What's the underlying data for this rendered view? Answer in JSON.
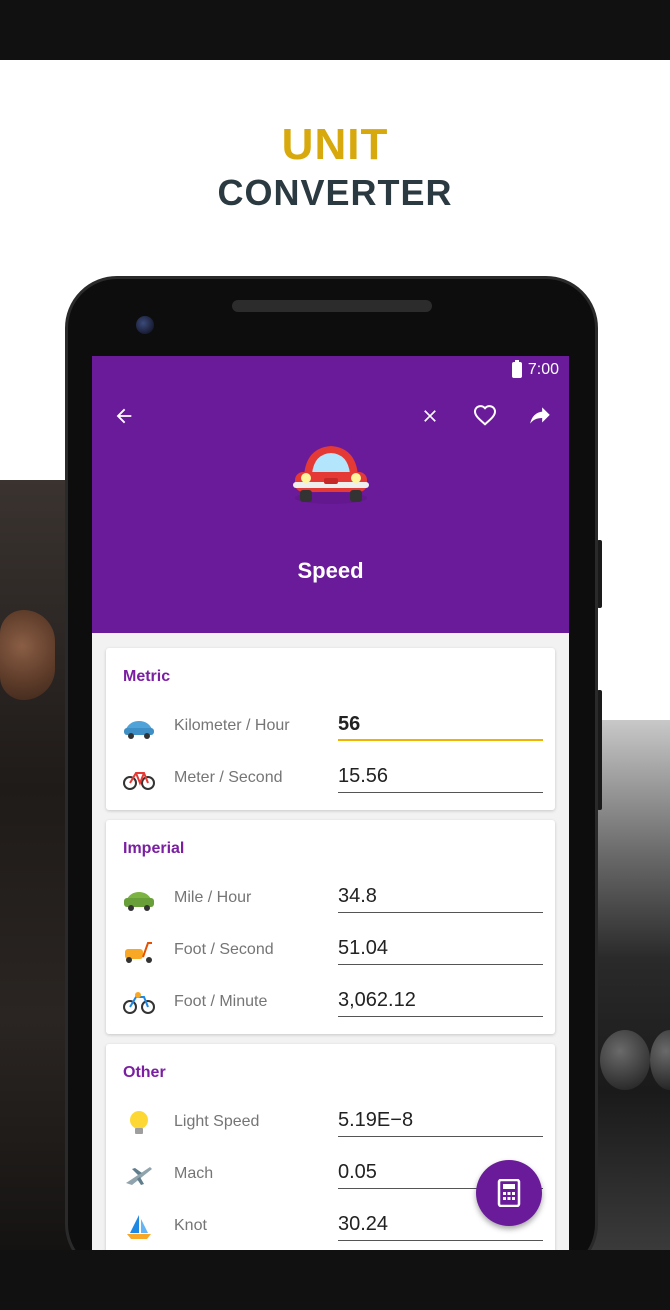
{
  "headline": {
    "line1": "UNIT",
    "line2": "CONVERTER"
  },
  "status_bar": {
    "time": "7:00"
  },
  "app_bar": {
    "title": "Speed",
    "icons": [
      "back-arrow-icon",
      "close-icon",
      "heart-icon",
      "share-icon",
      "car-icon"
    ]
  },
  "colors": {
    "primary": "#6a1b9a",
    "accent": "#f0b400",
    "section": "#7b1fa2",
    "headline_gold": "#d8a90c",
    "headline_dark": "#2b3a40"
  },
  "sections": [
    {
      "title": "Metric",
      "rows": [
        {
          "label": "Kilometer / Hour",
          "value": "56",
          "icon": "car-icon",
          "active": true
        },
        {
          "label": "Meter / Second",
          "value": "15.56",
          "icon": "bicycle-icon"
        }
      ]
    },
    {
      "title": "Imperial",
      "rows": [
        {
          "label": "Mile / Hour",
          "value": "34.8",
          "icon": "car-icon"
        },
        {
          "label": "Foot / Second",
          "value": "51.04",
          "icon": "scooter-icon"
        },
        {
          "label": "Foot / Minute",
          "value": "3,062.12",
          "icon": "bicycle-icon"
        }
      ]
    },
    {
      "title": "Other",
      "rows": [
        {
          "label": "Light Speed",
          "value": "5.19E−8",
          "icon": "lightbulb-icon"
        },
        {
          "label": "Mach",
          "value": "0.05",
          "icon": "airplane-icon"
        },
        {
          "label": "Knot",
          "value": "30.24",
          "icon": "sailboat-icon"
        }
      ]
    }
  ],
  "fab": {
    "icon": "calculator-icon"
  }
}
